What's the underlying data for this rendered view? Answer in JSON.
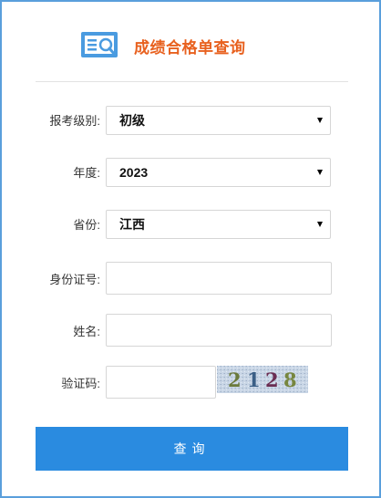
{
  "header": {
    "logo_icon": "search-document-icon",
    "title": "成绩合格单查询"
  },
  "form": {
    "level": {
      "label": "报考级别:",
      "value": "初级"
    },
    "year": {
      "label": "年度:",
      "value": "2023"
    },
    "province": {
      "label": "省份:",
      "value": "江西"
    },
    "id_number": {
      "label": "身份证号:",
      "value": ""
    },
    "name": {
      "label": "姓名:",
      "value": ""
    },
    "captcha": {
      "label": "验证码:",
      "value": "",
      "image_text": "2128"
    }
  },
  "submit_label": "查询",
  "colors": {
    "accent": "#2a8be0",
    "title": "#e8611f",
    "border": "#5a9fdc"
  }
}
